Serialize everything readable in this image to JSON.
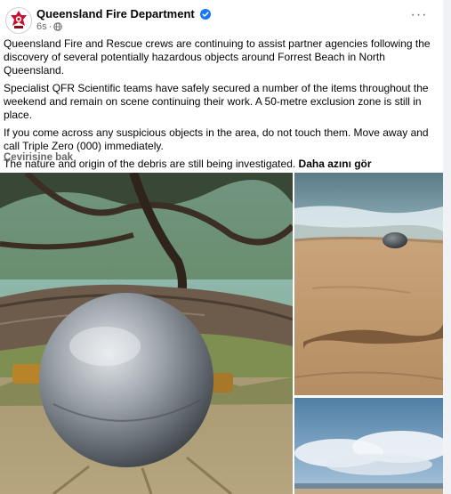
{
  "post": {
    "page_name": "Queensland Fire Department",
    "time": "6s",
    "more_label": "···",
    "paragraphs": [
      "Queensland Fire and Rescue crews are continuing to assist partner agencies following the discovery of several potentially hazardous objects around Forrest Beach in North Queensland.",
      "Specialist QFR Scientific teams have safely secured a number of the items throughout the weekend and remain on scene continuing their work. A 50-metre exclusion zone is still in place.",
      "If you come across any suspicious objects in the area, do not touch them. Move away and call Triple Zero (000) immediately.",
      "The nature and origin of the debris are still being investigated."
    ],
    "see_more_label": "Daha azını gör",
    "translate_label": "Çevirisine bak"
  },
  "photos": [
    {
      "name": "photo-metal-sphere-bush",
      "icon": "photo"
    },
    {
      "name": "photo-sphere-on-beach",
      "icon": "photo"
    },
    {
      "name": "photo-beach-sky",
      "icon": "photo"
    }
  ],
  "colors": {
    "text": "#050505",
    "secondary": "#65676b",
    "verified": "#1877f2",
    "brand_red": "#c8102e"
  }
}
